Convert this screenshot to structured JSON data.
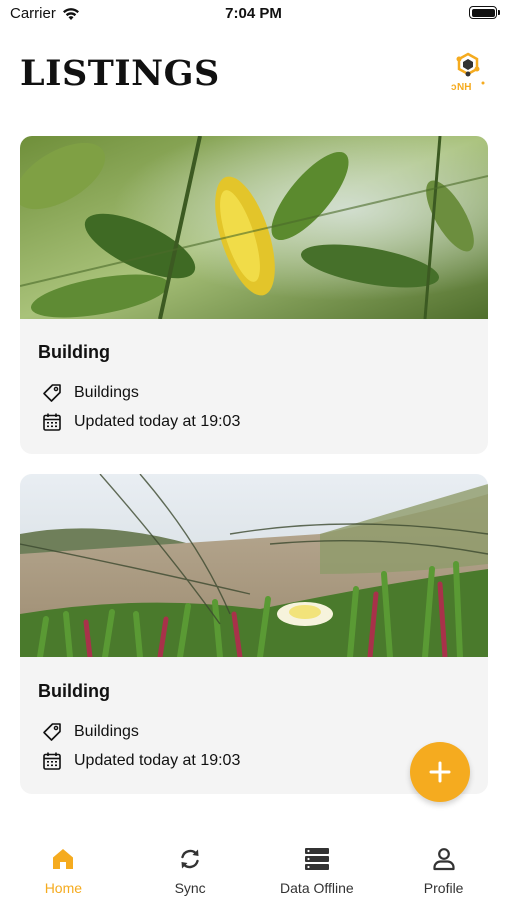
{
  "status_bar": {
    "carrier": "Carrier",
    "time": "7:04 PM"
  },
  "header": {
    "title": "LISTINGS",
    "logo_icon": "honeycomb-logo-icon",
    "logo_text": "NH"
  },
  "listings": [
    {
      "title": "Building",
      "category": "Buildings",
      "updated": "Updated today at 19:03",
      "image": "leaves-photo"
    },
    {
      "title": "Building",
      "category": "Buildings",
      "updated": "Updated today at 19:03",
      "image": "dune-flower-photo"
    }
  ],
  "fab": {
    "icon": "plus-icon"
  },
  "bottom_nav": [
    {
      "label": "Home",
      "icon": "home-icon",
      "active": true
    },
    {
      "label": "Sync",
      "icon": "sync-icon",
      "active": false
    },
    {
      "label": "Data Offline",
      "icon": "database-icon",
      "active": false
    },
    {
      "label": "Profile",
      "icon": "person-icon",
      "active": false
    }
  ],
  "colors": {
    "accent": "#f5ab1f",
    "card_bg": "#f4f4f4",
    "text": "#111111"
  }
}
